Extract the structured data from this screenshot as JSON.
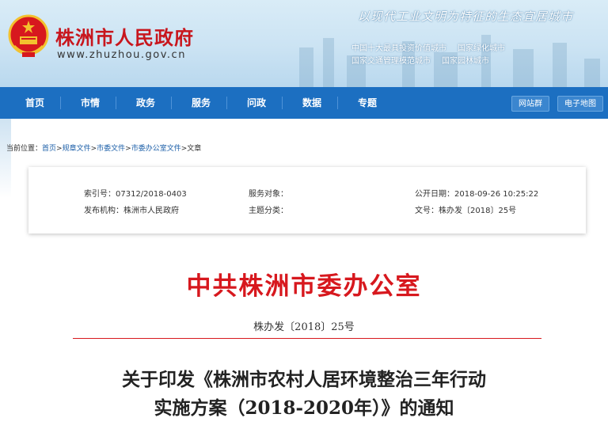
{
  "header": {
    "site_name": "株洲市人民政府",
    "site_url": "www.zhuzhou.gov.cn",
    "slogan": "以现代工业文明为特征的生态宜居城市",
    "honors": [
      "中国十大最具投资价值城市",
      "国家绿化城市",
      "国家交通管理模范城市",
      "国家园林城市"
    ]
  },
  "nav": {
    "items": [
      "首页",
      "市情",
      "政务",
      "服务",
      "问政",
      "数据",
      "专题"
    ],
    "buttons": [
      "网站群",
      "电子地图"
    ]
  },
  "breadcrumb": {
    "prefix": "当前位置：",
    "items": [
      "首页",
      "规章文件",
      "市委文件",
      "市委办公室文件",
      "文章"
    ]
  },
  "meta": {
    "index_no": "索引号：07312/2018-0403",
    "service_target": "服务对象：",
    "publish_time": "公开日期：2018-09-26 10:25:22",
    "publisher": "发布机构：株洲市人民政府",
    "subject": "主题分类：",
    "doc_no": "文号：株办发〔2018〕25号"
  },
  "document": {
    "issuer": "中共株洲市委办公室",
    "number": "株办发〔2018〕25号",
    "title_line1": "关于印发《株洲市农村人居环境整治三年行动",
    "title_line2": "实施方案（2018-2020年）》的通知"
  },
  "colors": {
    "brand_red": "#d7181e",
    "nav_blue": "#1c6fc1",
    "link_blue": "#1c5fa8"
  },
  "icons": {
    "emblem": "national-emblem-icon"
  }
}
